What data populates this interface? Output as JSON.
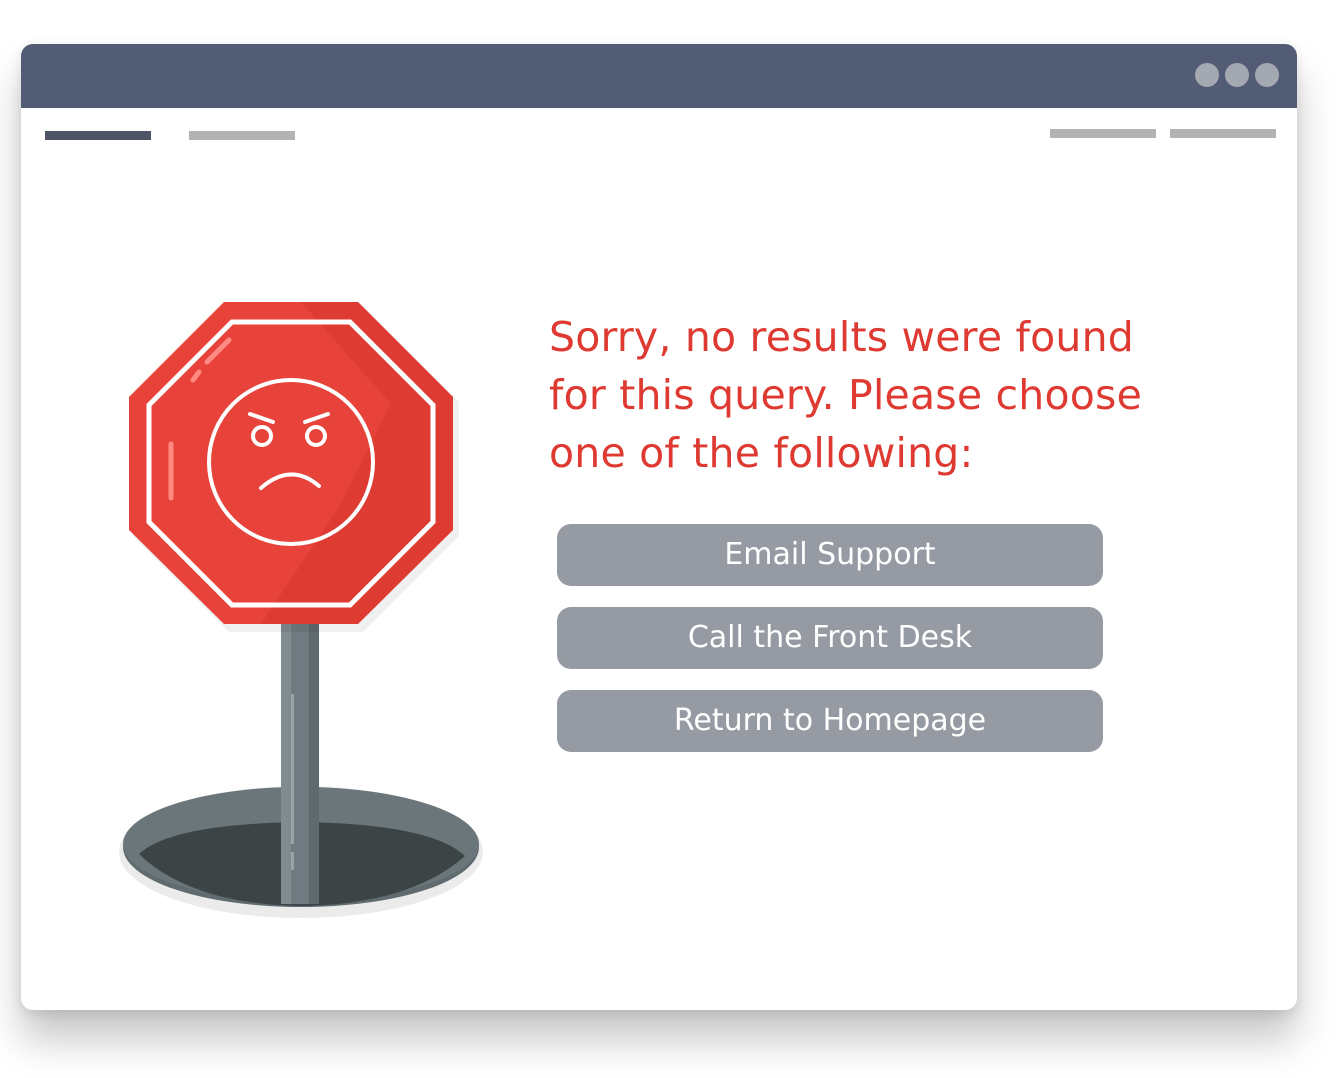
{
  "window": {
    "titlebar_color": "#525c74",
    "control_dots": [
      "dot",
      "dot",
      "dot"
    ]
  },
  "message": {
    "text": "Sorry, no results were found for this query. Please choose one of the following:",
    "color": "#de3a32"
  },
  "actions": [
    {
      "label": "Email Support"
    },
    {
      "label": "Call the Front Desk"
    },
    {
      "label": "Return to Homepage"
    }
  ],
  "illustration": {
    "icon": "stop-sign-sad-face-icon",
    "sign_color": "#e8423a"
  }
}
